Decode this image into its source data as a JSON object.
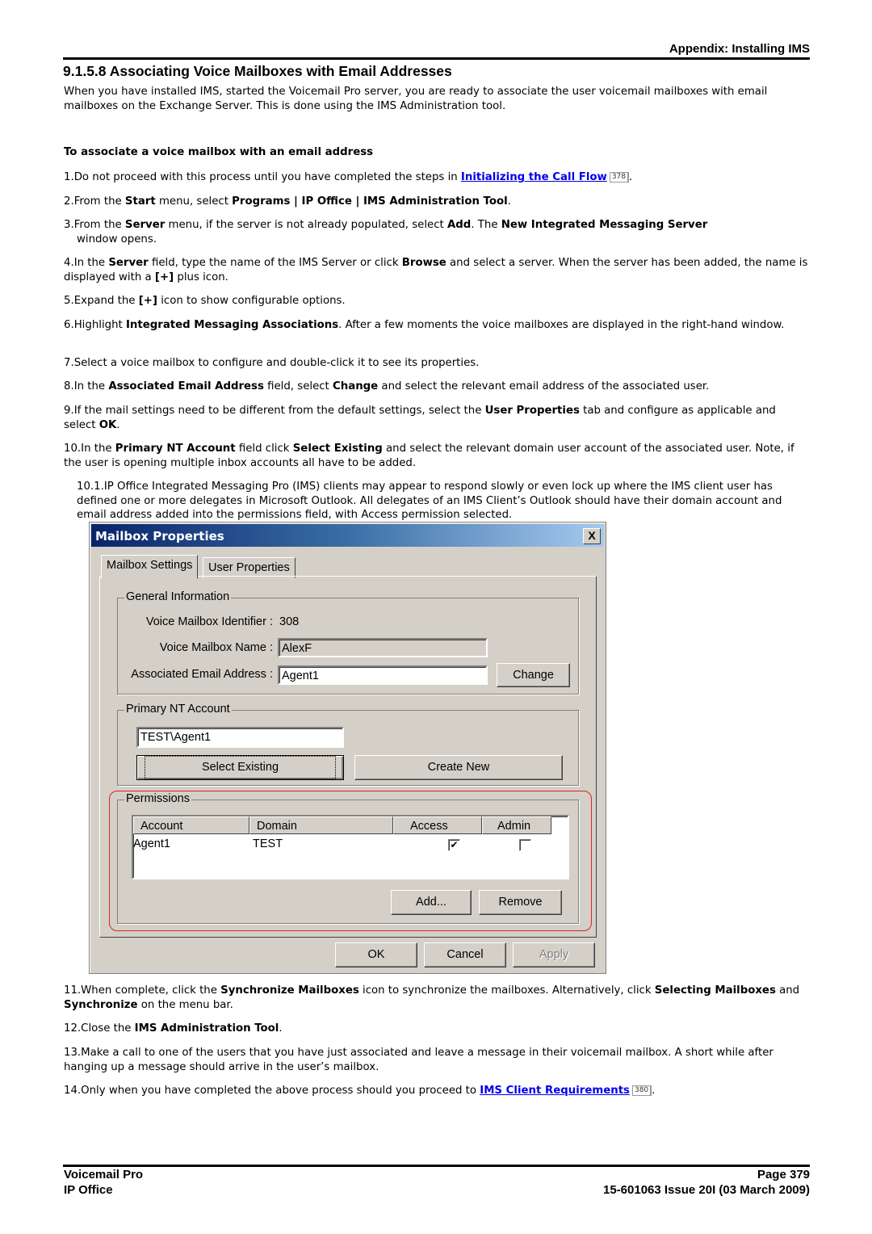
{
  "header": {
    "section": "Appendix: Installing IMS",
    "title": "9.1.5.8 Associating Voice Mailboxes with Email Addresses",
    "intro": "When you have installed IMS, started the Voicemail Pro server, you are ready to associate the user voicemail mailboxes with email mailboxes on the Exchange Server. This is done using the IMS Administration tool."
  },
  "procedure": {
    "heading": "To associate a voice mailbox with an email address",
    "steps": [
      {
        "num": "1.",
        "t0": "Do not proceed with this process until you have completed the steps in ",
        "link": "Initializing the Call Flow",
        "ref": "378",
        "t1": "."
      },
      {
        "num": "2.",
        "t0": "From the ",
        "b0": "Start",
        "t1": " menu, select ",
        "b1": "Programs | IP Office | IMS Administration Tool",
        "t2": "."
      },
      {
        "num": "3.",
        "t0": "From the ",
        "b0": "Server",
        "t1": " menu, if the server is not already populated, select ",
        "b1": "Add",
        "t2": ". The ",
        "b2": "New Integrated Messaging Server",
        "t3": " window opens."
      },
      {
        "num": "4.",
        "t0": "In the ",
        "b0": "Server",
        "t1": " field, type the name of the IMS Server or click ",
        "b1": "Browse",
        "t2": " and select a server. When the server has been added, the name is displayed with a ",
        "b2": "[+]",
        "t3": " plus icon."
      },
      {
        "num": "5.",
        "t0": "Expand the ",
        "b0": "[+]",
        "t1": " icon to show configurable options."
      },
      {
        "num": "6.",
        "t0": "Highlight ",
        "b0": "Integrated Messaging Associations",
        "t1": ". After a few moments the voice mailboxes are displayed in the right-hand window."
      },
      {
        "num": "7.",
        "t0": "Select a voice mailbox to configure and double-click it to see its properties."
      },
      {
        "num": "8.",
        "t0": "In the ",
        "b0": "Associated Email Address",
        "t1": " field, select ",
        "b1": "Change",
        "t2": " and select the relevant email address of the associated user."
      },
      {
        "num": "9.",
        "t0": "If the mail settings need to be different from the default settings, select the ",
        "b0": "User Properties",
        "t1": " tab and configure as applicable and select ",
        "b1": "OK",
        "t2": "."
      },
      {
        "num": "10.",
        "t0": "In the ",
        "b0": "Primary NT Account",
        "t1": " field click ",
        "b1": "Select Existing",
        "t2": " and select the relevant domain user account of the associated user. Note, if the user is opening multiple inbox accounts all have to be added."
      },
      {
        "num": "10.1.",
        "t0": "IP Office Integrated Messaging Pro (IMS) clients may appear to respond slowly or even lock up where the IMS client user has defined one or more delegates in Microsoft Outlook. All delegates of an IMS Client’s Outlook should have their domain account and email address added into the permissions field, with Access permission selected."
      },
      {
        "num": "11.",
        "t0": "When complete, click the ",
        "b0": "Synchronize Mailboxes",
        "t1": " icon to synchronize the mailboxes. Alternatively, click ",
        "b1": "Selecting Mailboxes",
        "t2": " and ",
        "b2": "Synchronize",
        "t3": " on the menu bar."
      },
      {
        "num": "12.",
        "t0": "Close the ",
        "b0": "IMS Administration Tool",
        "t1": "."
      },
      {
        "num": "13.",
        "t0": "Make a call to one of the users that you have just associated and leave a message in their voicemail mailbox. A short while after hanging up a message should arrive in the user’s mailbox."
      },
      {
        "num": "14.",
        "t0": "Only when you have completed the above process should you proceed to ",
        "link": "IMS Client Requirements",
        "ref": "380",
        "t1": "."
      }
    ]
  },
  "dialog": {
    "title": "Mailbox Properties",
    "close_glyph": "X",
    "tabs": [
      "Mailbox Settings",
      "User Properties"
    ],
    "general": {
      "label": "General Information",
      "id_label": "Voice Mailbox Identifier :",
      "id_value": "308",
      "name_label": "Voice Mailbox Name :",
      "name_value": "AlexF",
      "email_label": "Associated Email Address :",
      "email_value": "Agent1",
      "change_button": "Change"
    },
    "primary": {
      "label": "Primary NT Account",
      "account_value": "TEST\\Agent1",
      "select_existing": "Select Existing",
      "create_new": "Create New"
    },
    "permissions": {
      "label": "Permissions",
      "columns": [
        "Account",
        "Domain",
        "Access",
        "Admin"
      ],
      "rows": [
        {
          "account": "Agent1",
          "domain": "TEST",
          "access": true,
          "admin": false
        }
      ],
      "add_button": "Add...",
      "remove_button": "Remove"
    },
    "footer_buttons": {
      "ok": "OK",
      "cancel": "Cancel",
      "apply": "Apply"
    },
    "highlight_color": "#e02020"
  },
  "footer": {
    "product": "Voicemail Pro",
    "page": "Page 379",
    "platform": "IP Office",
    "issue": "15-601063 Issue 20I (03 March 2009)"
  },
  "check_glyph": "✔"
}
